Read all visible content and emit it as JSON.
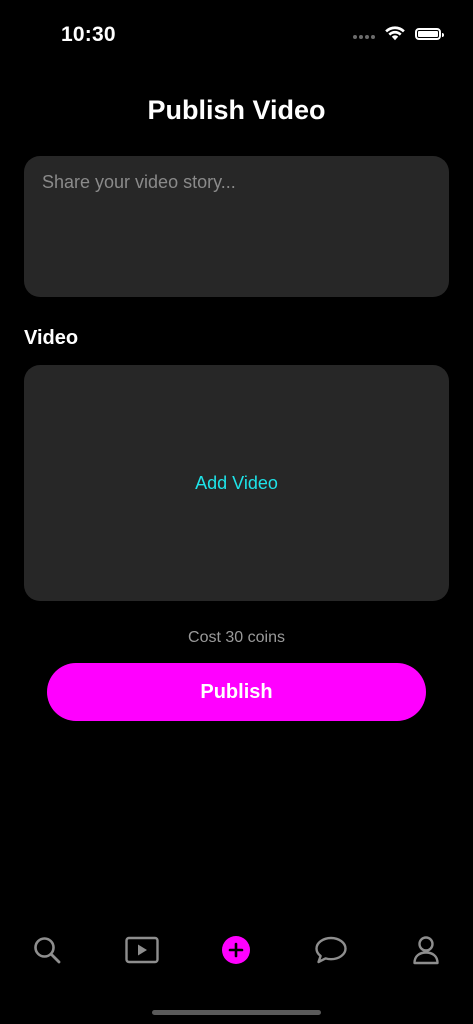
{
  "status_bar": {
    "time": "10:30",
    "icons": [
      "signal-dots-icon",
      "wifi-icon",
      "battery-icon"
    ]
  },
  "header": {
    "title": "Publish Video"
  },
  "story": {
    "placeholder": "Share your video story...",
    "value": ""
  },
  "video_section": {
    "label": "Video",
    "add_label": "Add Video"
  },
  "cost": {
    "text": "Cost 30 coins"
  },
  "publish": {
    "label": "Publish"
  },
  "tab_bar": {
    "items": [
      {
        "icon": "search-icon",
        "active": false
      },
      {
        "icon": "play-video-icon",
        "active": false
      },
      {
        "icon": "plus-circle-icon",
        "active": true
      },
      {
        "icon": "chat-bubble-icon",
        "active": false
      },
      {
        "icon": "profile-icon",
        "active": false
      }
    ]
  },
  "colors": {
    "background": "#000000",
    "card": "#272727",
    "accent": "#ff00ff",
    "link": "#1ee3e8",
    "muted_text": "#9a9a9a",
    "tab_icon": "#8e8e8e"
  }
}
